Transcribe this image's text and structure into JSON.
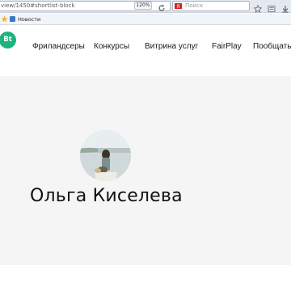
{
  "browser": {
    "url": "view/1450#shortlist-block",
    "zoom": "120%",
    "search_placeholder": "Поиск",
    "bookmarks": [
      {
        "label": "Новости"
      }
    ]
  },
  "site": {
    "logo_text": "Bt",
    "brand_color": "#1db37d",
    "nav": [
      {
        "label": "Фриландсеры"
      },
      {
        "label": "Конкурсы"
      },
      {
        "label": "Витрина услуг"
      },
      {
        "label": "FairPlay"
      },
      {
        "label": "Пообщать"
      }
    ]
  },
  "profile": {
    "name": "Ольга Киселева"
  }
}
